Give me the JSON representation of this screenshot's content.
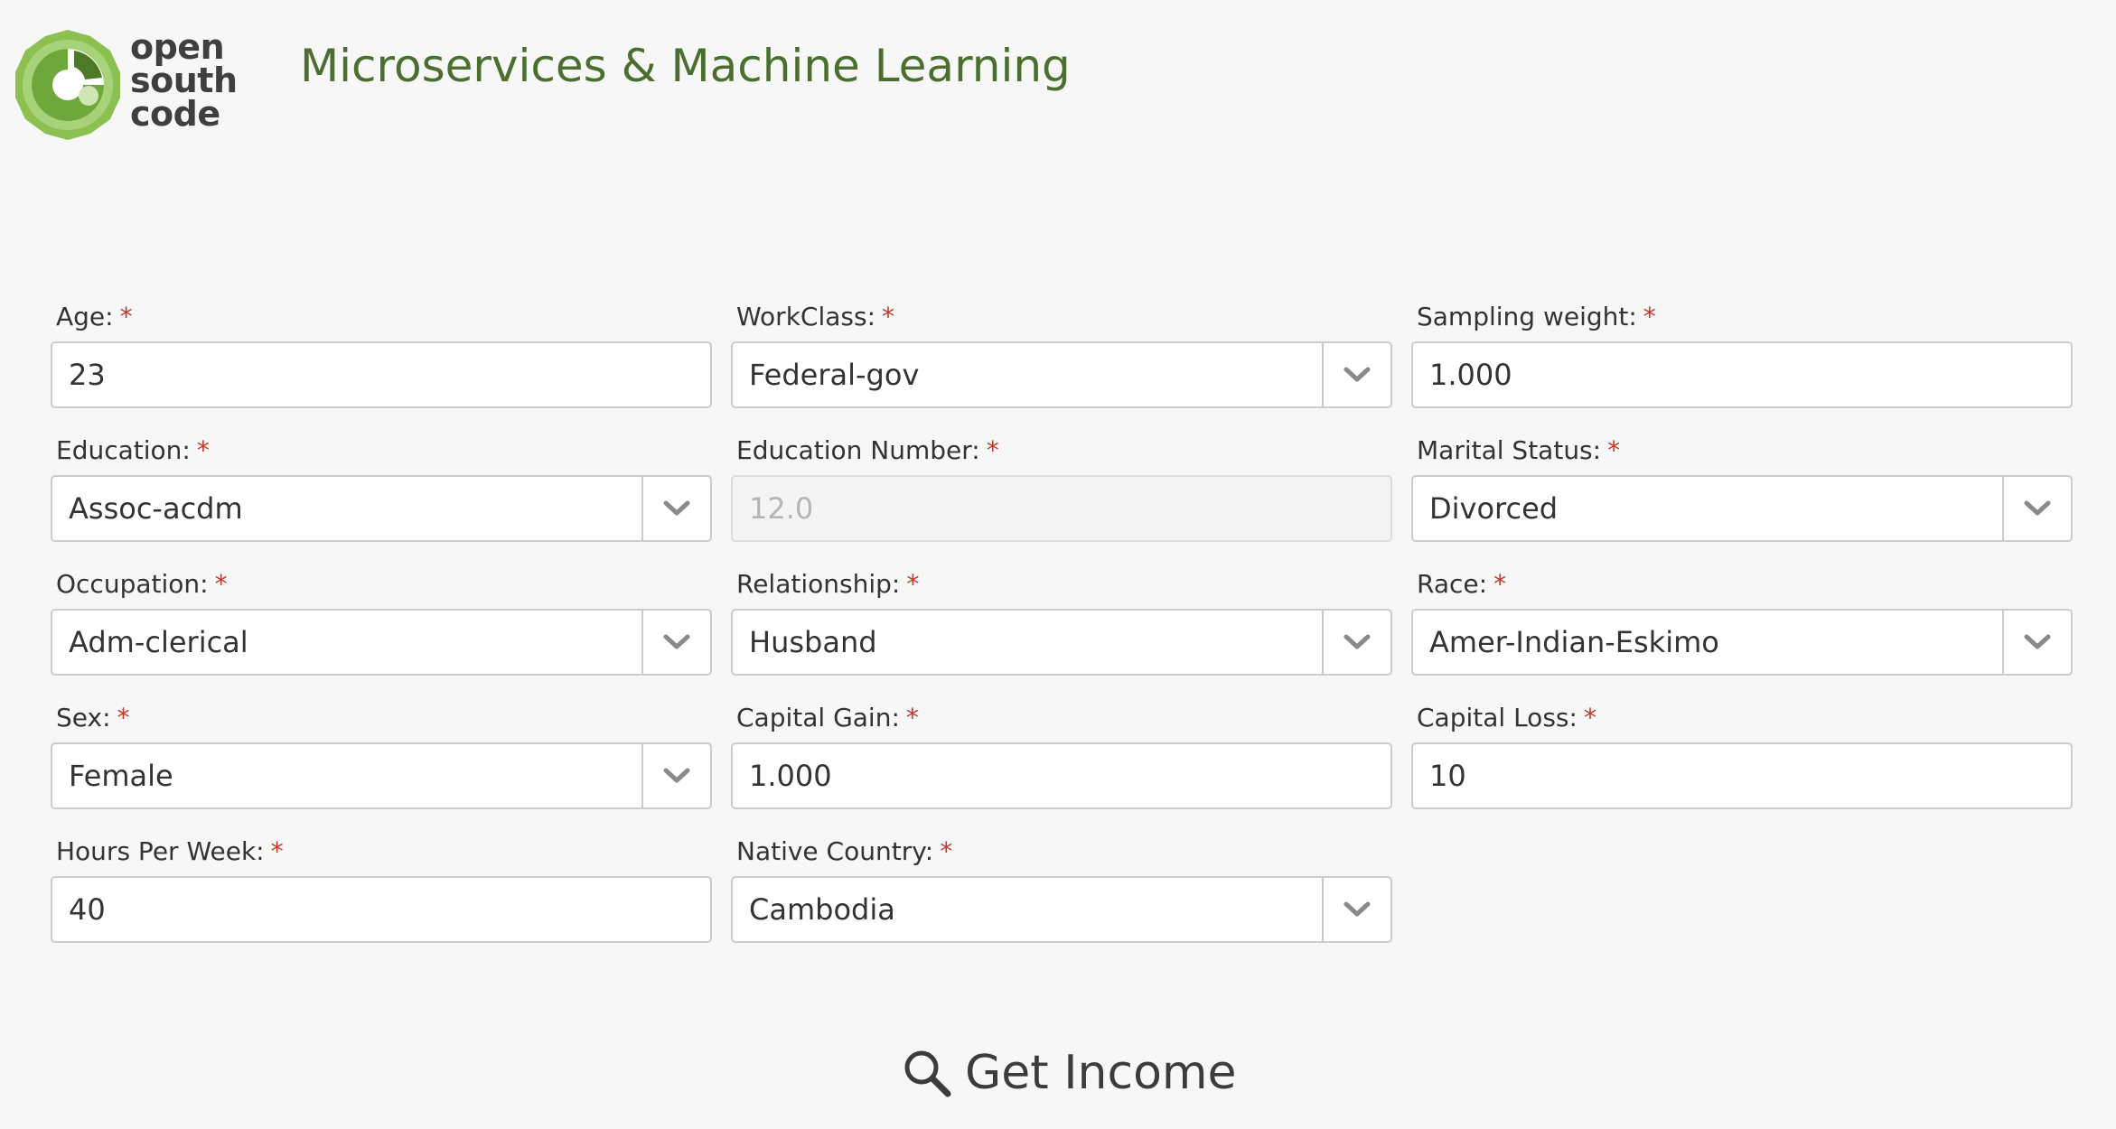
{
  "header": {
    "logo_lines": [
      "open",
      "south",
      "code"
    ],
    "title": "Microservices & Machine Learning",
    "brand_colors": {
      "title_green": "#4a6f2e",
      "logo_light_green": "#8cc152",
      "logo_dark_green": "#5b7a2f"
    }
  },
  "form": {
    "required_marker": "*",
    "required_color": "#c0392b",
    "dropdown_icon": "chevron-down-icon",
    "fields": [
      {
        "id": "age",
        "label": "Age:",
        "type": "input",
        "value": "23"
      },
      {
        "id": "workclass",
        "label": "WorkClass:",
        "type": "select",
        "value": "Federal-gov"
      },
      {
        "id": "sampling_weight",
        "label": "Sampling weight:",
        "type": "input",
        "value": "1.000"
      },
      {
        "id": "education",
        "label": "Education:",
        "type": "select",
        "value": "Assoc-acdm"
      },
      {
        "id": "education_number",
        "label": "Education Number:",
        "type": "input",
        "value": "12.0",
        "disabled": true
      },
      {
        "id": "marital_status",
        "label": "Marital Status:",
        "type": "select",
        "value": "Divorced"
      },
      {
        "id": "occupation",
        "label": "Occupation:",
        "type": "select",
        "value": "Adm-clerical"
      },
      {
        "id": "relationship",
        "label": "Relationship:",
        "type": "select",
        "value": "Husband"
      },
      {
        "id": "race",
        "label": "Race:",
        "type": "select",
        "value": "Amer-Indian-Eskimo"
      },
      {
        "id": "sex",
        "label": "Sex:",
        "type": "select",
        "value": "Female"
      },
      {
        "id": "capital_gain",
        "label": "Capital Gain:",
        "type": "input",
        "value": "1.000"
      },
      {
        "id": "capital_loss",
        "label": "Capital Loss:",
        "type": "input",
        "value": "10"
      },
      {
        "id": "hours_per_week",
        "label": "Hours Per Week:",
        "type": "input",
        "value": "40"
      },
      {
        "id": "native_country",
        "label": "Native Country:",
        "type": "select",
        "value": "Cambodia"
      }
    ]
  },
  "submit": {
    "label": "Get Income",
    "icon": "search-icon"
  }
}
